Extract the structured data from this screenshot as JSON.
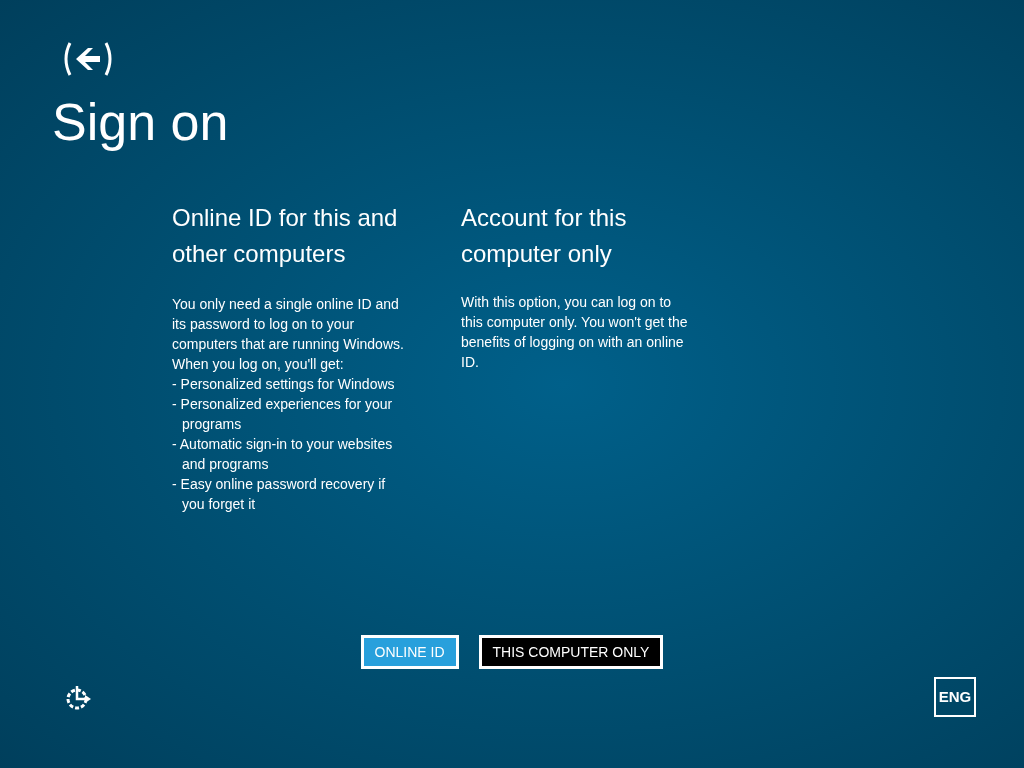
{
  "title": "Sign on",
  "options": [
    {
      "heading": "Online ID for this and other computers",
      "intro": "You only need a single online ID and its password to log on to your computers that are running Windows. When you log on, you'll get:",
      "bullets": [
        "- Personalized settings for Windows",
        "- Personalized experiences for your programs",
        "- Automatic sign-in to your websites and programs",
        "- Easy online password recovery if you forget it"
      ]
    },
    {
      "heading": "Account for this computer only",
      "intro": "With this option, you can log on to this computer only. You won't get the benefits of logging on with an online ID."
    }
  ],
  "buttons": [
    {
      "label": "ONLINE ID",
      "kind": "primary"
    },
    {
      "label": "THIS COMPUTER ONLY",
      "kind": "dark"
    }
  ],
  "language": "ENG"
}
